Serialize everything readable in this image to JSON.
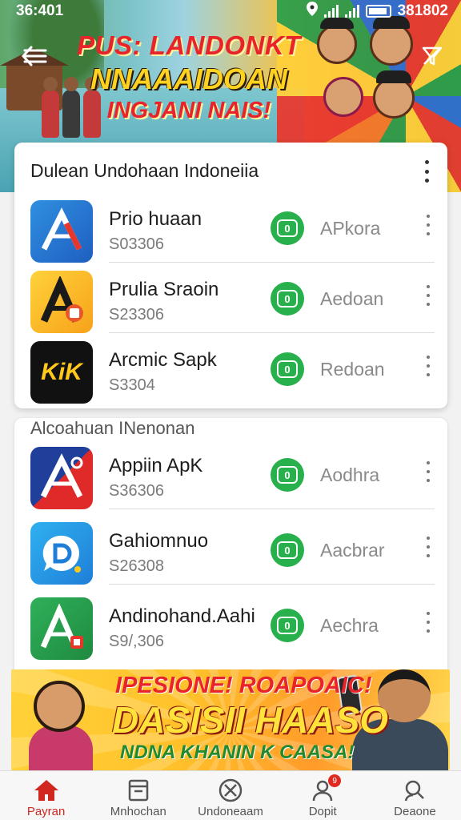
{
  "status_bar": {
    "time": "36:401",
    "right_text": "381802"
  },
  "hero": {
    "line1": "PUS: LANDONKT",
    "line2": "NNAAAIDOAN",
    "line3": "INGJANI NAIS!"
  },
  "card1": {
    "header": "Dulean Undohaan Indoneiia",
    "apps": [
      {
        "name": "Prio huaan",
        "price": "S03306",
        "download_label": "APkora",
        "icon_text": "A",
        "icon": "blue-a-icon"
      },
      {
        "name": "Prulia Sraoin",
        "price": "S23306",
        "download_label": "Aedoan",
        "icon_text": "A",
        "icon": "yellow-a-icon"
      },
      {
        "name": "Arcmic Sapk",
        "price": "S3304",
        "download_label": "Redoan",
        "icon_text": "KiK",
        "icon": "kik-icon"
      }
    ]
  },
  "section2": {
    "title": "Alcoahuan INenonan",
    "apps": [
      {
        "name": "Appiin ApK",
        "price": "S36306",
        "download_label": "Aodhra",
        "icon_text": "A",
        "icon": "red-a-icon"
      },
      {
        "name": "Gahiomnuo",
        "price": "S26308",
        "download_label": "Aacbrar",
        "icon_text": "D",
        "icon": "chat-d-icon"
      },
      {
        "name": "Andinohand.Aahi",
        "price": "S9/,306",
        "download_label": "Aechra",
        "icon_text": "A",
        "icon": "green-a-icon"
      }
    ]
  },
  "download_button_glyph": "0",
  "promo": {
    "line1": "IPESIONE! ROAPOAIC!",
    "line2": "DASISII HAASO",
    "line3": "NDNA KHANIN K CAASA!"
  },
  "bottom_nav": [
    {
      "label": "Payran",
      "icon": "home-icon",
      "active": true
    },
    {
      "label": "Mnhochan",
      "icon": "store-icon",
      "active": false
    },
    {
      "label": "Undoneaam",
      "icon": "download-icon",
      "active": false
    },
    {
      "label": "Dopit",
      "icon": "profile-icon",
      "active": false,
      "badge": "9"
    },
    {
      "label": "Deaone",
      "icon": "search-icon",
      "active": false
    }
  ],
  "colors": {
    "accent_red": "#d0281f",
    "download_green": "#27b04b"
  }
}
